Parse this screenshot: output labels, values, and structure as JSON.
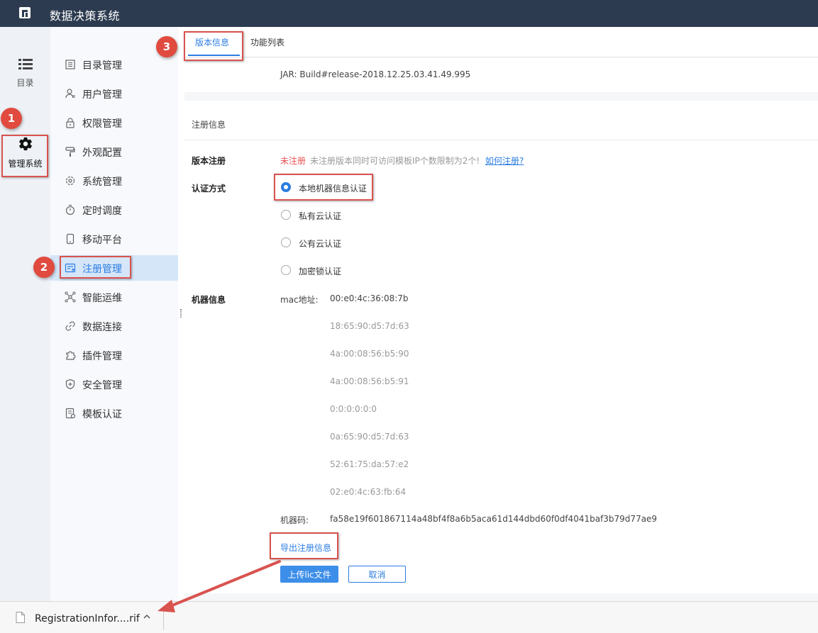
{
  "app": {
    "title": "数据决策系统"
  },
  "iconbar": {
    "items": [
      {
        "label": "目录",
        "icon": "list-icon"
      },
      {
        "label": "管理系统",
        "icon": "gear-icon"
      }
    ]
  },
  "menu": {
    "items": [
      {
        "label": "目录管理",
        "icon": "catalog-icon"
      },
      {
        "label": "用户管理",
        "icon": "user-icon"
      },
      {
        "label": "权限管理",
        "icon": "lock-icon"
      },
      {
        "label": "外观配置",
        "icon": "paint-roller-icon"
      },
      {
        "label": "系统管理",
        "icon": "settings-icon"
      },
      {
        "label": "定时调度",
        "icon": "timer-icon"
      },
      {
        "label": "移动平台",
        "icon": "mobile-icon"
      },
      {
        "label": "注册管理",
        "icon": "registration-icon",
        "active": true
      },
      {
        "label": "智能运维",
        "icon": "network-icon"
      },
      {
        "label": "数据连接",
        "icon": "link-icon"
      },
      {
        "label": "插件管理",
        "icon": "puzzle-icon"
      },
      {
        "label": "安全管理",
        "icon": "shield-icon"
      },
      {
        "label": "模板认证",
        "icon": "template-icon"
      }
    ]
  },
  "tabs": [
    {
      "label": "版本信息",
      "active": true
    },
    {
      "label": "功能列表",
      "active": false
    }
  ],
  "version": {
    "jar": "JAR: Build#release-2018.12.25.03.41.49.995"
  },
  "registration": {
    "section_title": "注册信息",
    "version_label": "版本注册",
    "status": "未注册",
    "status_note": "未注册版本同时可访问模板IP个数限制为2个!",
    "howto_link": "如何注册?",
    "auth_label": "认证方式",
    "auth_options": [
      {
        "label": "本地机器信息认证",
        "checked": true
      },
      {
        "label": "私有云认证",
        "checked": false
      },
      {
        "label": "公有云认证",
        "checked": false
      },
      {
        "label": "加密锁认证",
        "checked": false
      }
    ],
    "machine_label": "机器信息",
    "mac_label": "mac地址:",
    "macs": [
      "00:e0:4c:36:08:7b",
      "18:65:90:d5:7d:63",
      "4a:00:08:56:b5:90",
      "4a:00:08:56:b5:91",
      "0:0:0:0:0:0",
      "0a:65:90:d5:7d:63",
      "52:61:75:da:57:e2",
      "02:e0:4c:63:fb:64"
    ],
    "code_label": "机器码:",
    "code": "fa58e19f601867114a48bf4f8a6b5aca61d144dbd60f0df4041baf3b79d77ae9",
    "export_link": "导出注册信息",
    "upload_button": "上传lic文件",
    "cancel_button": "取消"
  },
  "download_bar": {
    "filename": "RegistrationInfor....rif",
    "icon": "file-icon"
  },
  "annotations": {
    "badges": [
      "1",
      "2",
      "3"
    ]
  },
  "colors": {
    "accent": "#2b7de2",
    "topbar": "#2c3b4f",
    "highlight": "#d9534f",
    "warning": "#e85050"
  }
}
